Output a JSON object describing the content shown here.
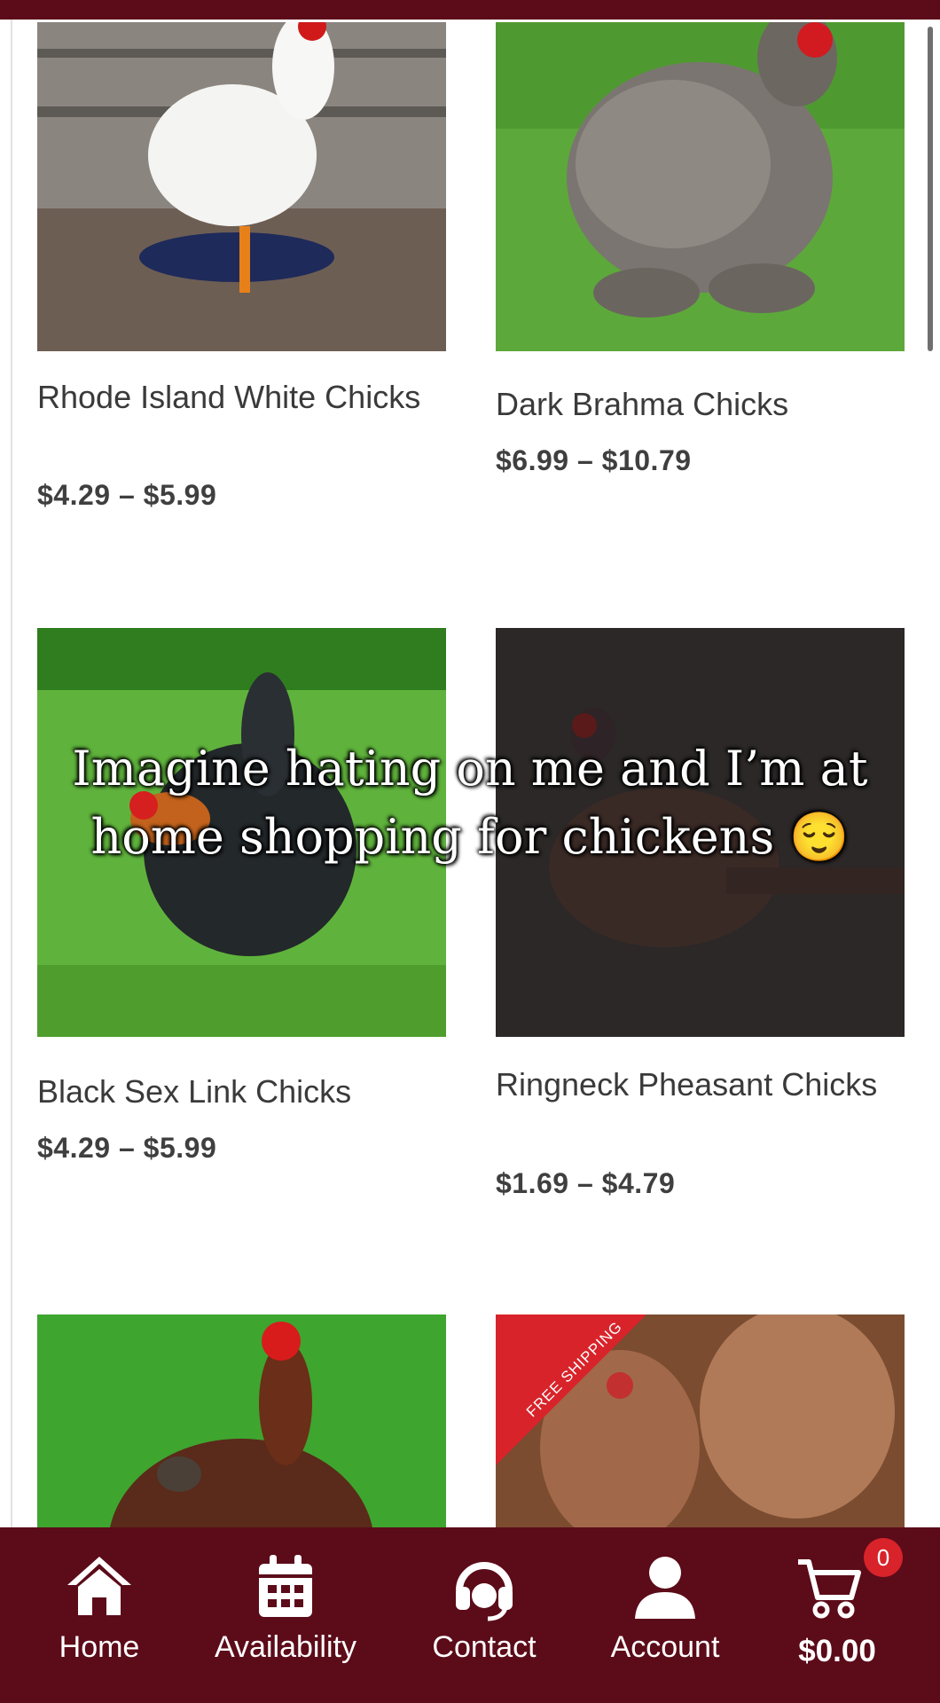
{
  "products": [
    {
      "title": "Rhode Island White Chicks",
      "price": "$4.29 – $5.99"
    },
    {
      "title": "Dark Brahma Chicks",
      "price": "$6.99 – $10.79"
    },
    {
      "title": "Black Sex Link Chicks",
      "price": "$4.29 – $5.99"
    },
    {
      "title": "Ringneck Pheasant Chicks",
      "price": "$1.69 – $4.79"
    }
  ],
  "promo_ribbon": "FREE SHIPPING",
  "overlay_caption": "Imagine hating on me and I’m at home shopping for chickens 😌",
  "bottom_nav": {
    "home": "Home",
    "availability": "Availability",
    "contact": "Contact",
    "account": "Account",
    "cart_total": "$0.00",
    "cart_count": "0"
  },
  "icons": [
    "home-icon",
    "calendar-icon",
    "headset-icon",
    "user-icon",
    "cart-icon"
  ],
  "colors": {
    "brand": "#5c0b19",
    "badge": "#d8232a",
    "ribbon": "#d8232a"
  }
}
